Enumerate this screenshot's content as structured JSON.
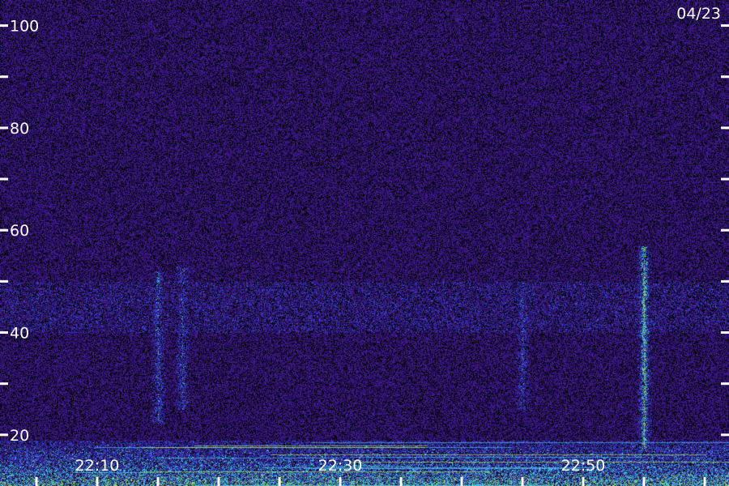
{
  "chart_data": {
    "type": "heatmap",
    "date_label": "04/23",
    "y_axis": {
      "ylim": [
        10,
        105
      ],
      "major_ticks": [
        20,
        40,
        60,
        80,
        100
      ],
      "minor_ticks": [
        30,
        50,
        70,
        90
      ],
      "tick_labels": [
        "20",
        "40",
        "60",
        "80",
        "100"
      ]
    },
    "x_axis": {
      "xlim": [
        "22:02",
        "22:62"
      ],
      "major_ticks": [
        "22:10",
        "22:30",
        "22:50"
      ],
      "tick_labels": [
        "22:10",
        "22:30",
        "22:50"
      ]
    },
    "palette": {
      "background": "#1e0850",
      "noise_dark": "#000000",
      "noise_mid": "#4a1fa8",
      "enhanced": "#3d58ff",
      "strong": "#4fe0ff",
      "peak": "#c8ff4a",
      "axis": "#ffffff"
    },
    "features": [
      {
        "kind": "vertical-band",
        "time": "22:15",
        "y_range": [
          22,
          52
        ],
        "intensity": 0.55
      },
      {
        "kind": "vertical-band",
        "time": "22:17",
        "y_range": [
          25,
          53
        ],
        "intensity": 0.5
      },
      {
        "kind": "vertical-band",
        "time": "22:45",
        "y_range": [
          25,
          50
        ],
        "intensity": 0.45
      },
      {
        "kind": "vertical-band",
        "time": "22:55",
        "y_range": [
          17,
          57
        ],
        "intensity": 0.85
      },
      {
        "kind": "diffuse-band",
        "y_range": [
          40,
          50
        ],
        "intensity": 0.3
      },
      {
        "kind": "low-band",
        "y_range": [
          10,
          19
        ],
        "intensity": 0.8
      }
    ]
  }
}
